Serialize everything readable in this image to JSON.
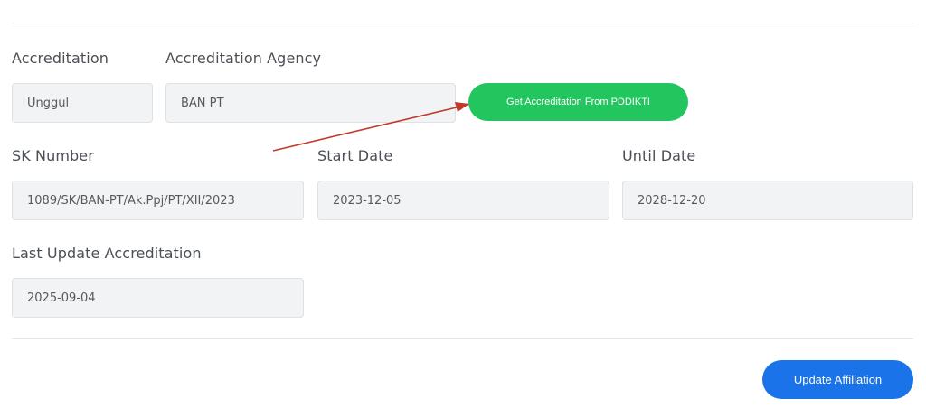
{
  "accreditation": {
    "label": "Accreditation",
    "value": "Unggul"
  },
  "accreditation_agency": {
    "label": "Accreditation Agency",
    "value": "BAN PT"
  },
  "get_accreditation_button": {
    "label": "Get Accreditation From PDDIKTI",
    "color": "#22c55e"
  },
  "sk_number": {
    "label": "SK Number",
    "value": "1089/SK/BAN-PT/Ak.Ppj/PT/XII/2023"
  },
  "start_date": {
    "label": "Start Date",
    "value": "2023-12-05"
  },
  "until_date": {
    "label": "Until Date",
    "value": "2028-12-20"
  },
  "last_update_accreditation": {
    "label": "Last Update Accreditation",
    "value": "2025-09-04"
  },
  "update_affiliation_button": {
    "label": "Update Affiliation",
    "color": "#1a73e8"
  },
  "annotation_arrow": {
    "color": "#c0392b"
  }
}
